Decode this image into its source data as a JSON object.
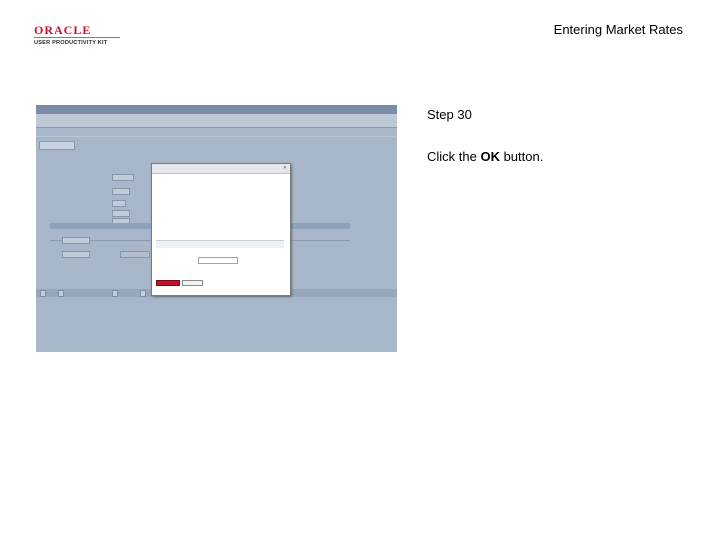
{
  "logo": {
    "brand": "ORACLE",
    "subtitle": "USER PRODUCTIVITY KIT"
  },
  "header": {
    "title": "Entering Market Rates"
  },
  "step": {
    "label": "Step 30"
  },
  "instruction": {
    "prefix": "Click the ",
    "target": "OK",
    "suffix": " button."
  }
}
